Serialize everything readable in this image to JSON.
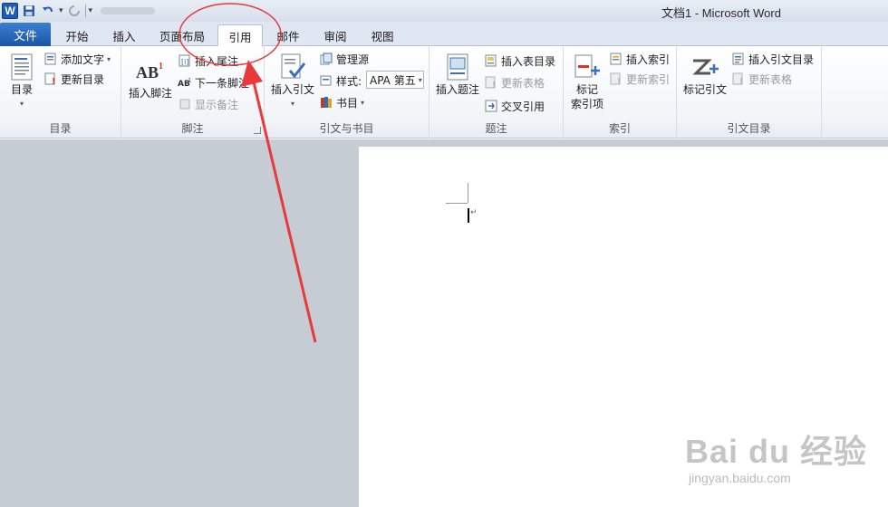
{
  "window": {
    "title": "文档1 - Microsoft Word"
  },
  "qat": {
    "logo": "W"
  },
  "tabs": {
    "file": "文件",
    "items": [
      "开始",
      "插入",
      "页面布局",
      "引用",
      "邮件",
      "审阅",
      "视图"
    ],
    "active": "引用"
  },
  "ribbon": {
    "toc": {
      "label": "目录",
      "toc_button": "目录",
      "add_text": "添加文字",
      "update_toc": "更新目录"
    },
    "footnotes": {
      "label": "脚注",
      "insert_footnote": "插入脚注",
      "insert_endnote": "插入尾注",
      "next_footnote": "下一条脚注",
      "show_notes": "显示备注"
    },
    "citations": {
      "label": "引文与书目",
      "insert_citation": "插入引文",
      "manage_sources": "管理源",
      "style_label": "样式:",
      "style_value": "APA 第五",
      "bibliography": "书目"
    },
    "captions": {
      "label": "题注",
      "insert_caption": "插入题注",
      "insert_table_of_figures": "插入表目录",
      "update_table": "更新表格",
      "cross_reference": "交叉引用"
    },
    "index": {
      "label": "索引",
      "mark_entry_line1": "标记",
      "mark_entry_line2": "索引项",
      "insert_index": "插入索引",
      "update_index": "更新索引"
    },
    "toa": {
      "label": "引文目录",
      "mark_citation": "标记引文",
      "insert_toa": "插入引文目录",
      "update_table": "更新表格"
    }
  },
  "watermark": {
    "logo": "Bai du 经验",
    "url": "jingyan.baidu.com"
  },
  "annotation": {
    "color": "#e8393b"
  }
}
